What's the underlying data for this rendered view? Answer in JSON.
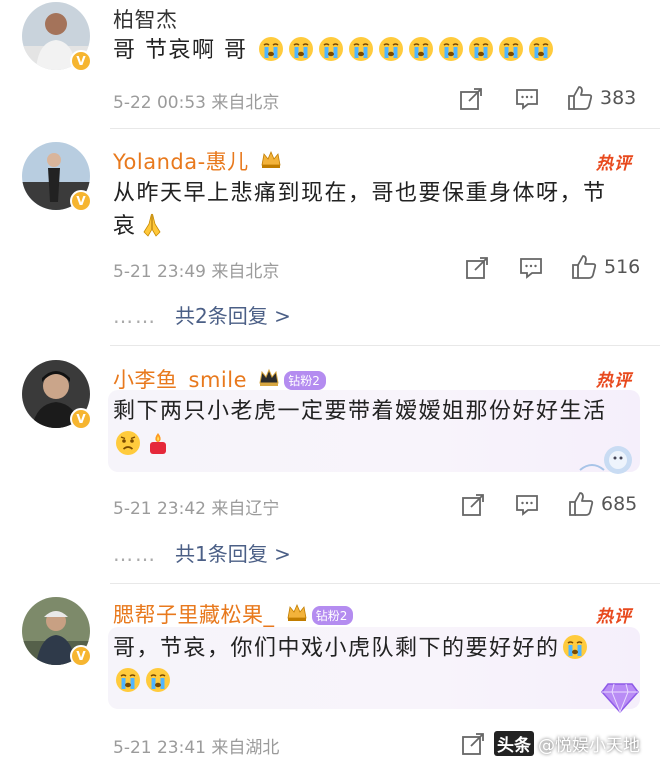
{
  "comments": [
    {
      "username": "柏智杰",
      "text": "哥 节哀啊 哥",
      "emojis": [
        "crying-face-emoji",
        "crying-face-emoji",
        "crying-face-emoji",
        "crying-face-emoji",
        "crying-face-emoji",
        "crying-face-emoji",
        "crying-face-emoji",
        "crying-face-emoji",
        "crying-face-emoji",
        "crying-face-emoji"
      ],
      "meta": "5-22 00:53 来自北京",
      "likes": "383"
    },
    {
      "username": "Yolanda-惠儿",
      "hot_label": "热评",
      "text_line1": "从昨天早上悲痛到现在，哥也要保重身体呀，节",
      "text_line2": "哀",
      "meta": "5-21 23:49 来自北京",
      "likes": "516",
      "replies": "共2条回复 >"
    },
    {
      "username": "小李鱼_smile",
      "fan_badge": "钻粉2",
      "hot_label": "热评",
      "text": "剩下两只小老虎一定要带着嫒嫒姐那份好好生活",
      "meta": "5-21 23:42 来自辽宁",
      "likes": "685",
      "replies": "共1条回复 >"
    },
    {
      "username": "腮帮子里藏松果_",
      "fan_badge": "钻粉2",
      "hot_label": "热评",
      "text": "哥，节哀，你们中戏小虎队剩下的要好好的",
      "meta": "5-21 23:41 来自湖北"
    }
  ],
  "replies_dots": "……",
  "watermark": {
    "logo": "头条",
    "text": "@悦娱小天地"
  },
  "colors": {
    "username_orange": "#e8791d",
    "hot_red": "#e8491d",
    "reply_link": "#4b5f86",
    "verified_badge": "#f6b530"
  }
}
